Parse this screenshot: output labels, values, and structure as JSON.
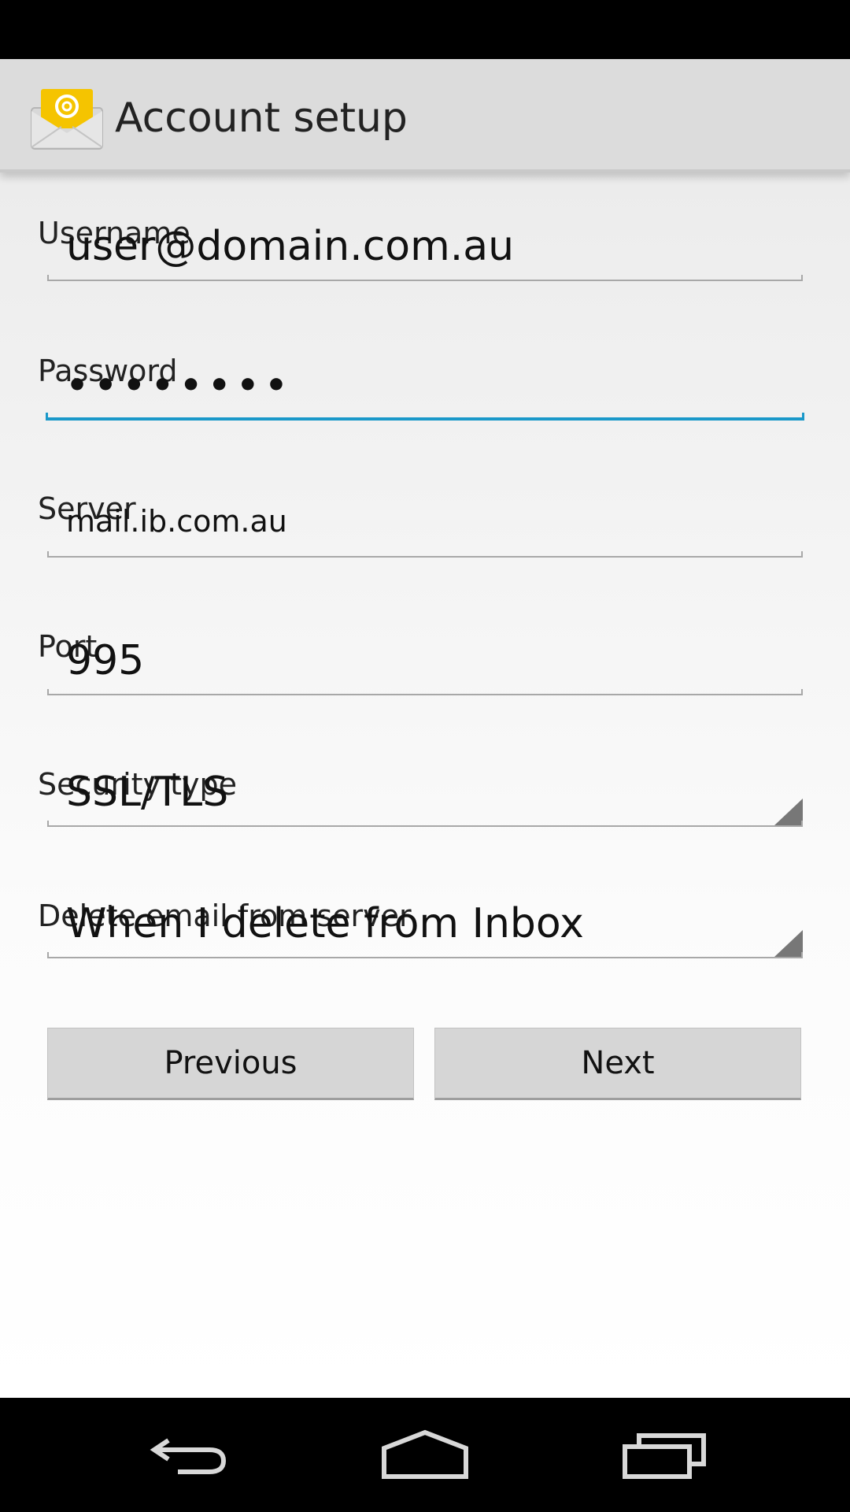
{
  "app": {
    "title": "Account setup",
    "icon": "email-envelope-icon"
  },
  "form": {
    "username": {
      "label": "Username",
      "value": "user@domain.com.au"
    },
    "password": {
      "label": "Password",
      "value": "••••••••"
    },
    "server": {
      "label": "Server",
      "value": "mail.ib.com.au"
    },
    "port": {
      "label": "Port",
      "value": "995"
    },
    "security_type": {
      "label": "Security type",
      "value": "SSL/TLS"
    },
    "delete_email": {
      "label": "Delete email from server",
      "value": "When I delete from Inbox"
    }
  },
  "buttons": {
    "previous": "Previous",
    "next": "Next"
  },
  "nav": {
    "back": "back-icon",
    "home": "home-icon",
    "recents": "recent-apps-icon"
  },
  "colors": {
    "focus_accent": "#1a98c9",
    "icon_yellow": "#f5c400"
  }
}
